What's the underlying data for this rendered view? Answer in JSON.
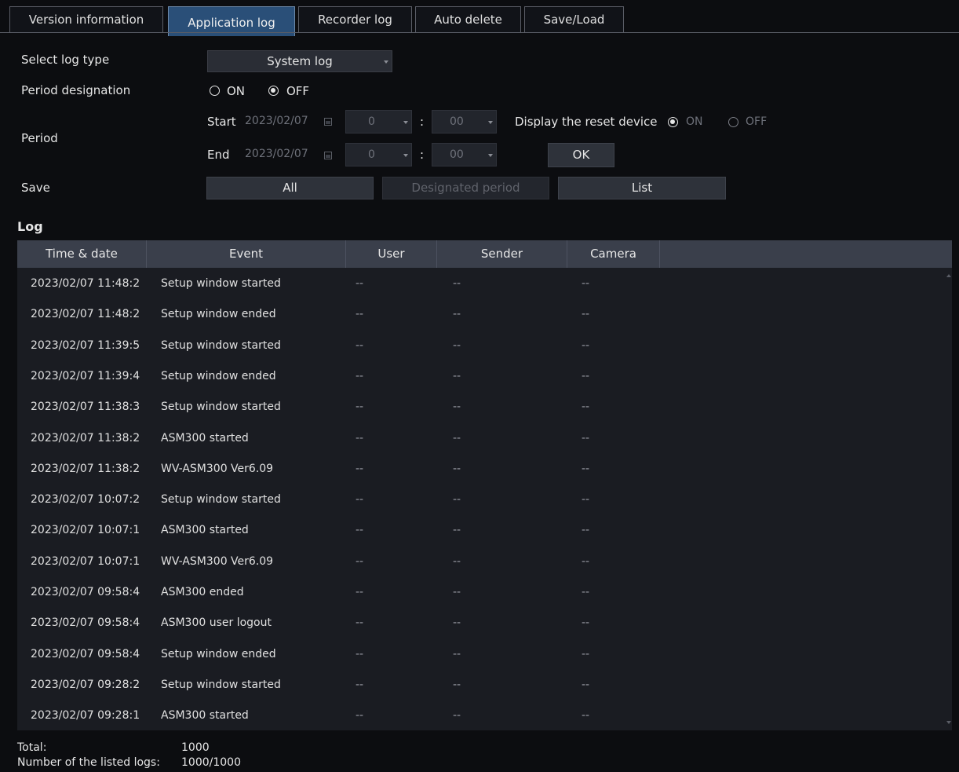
{
  "tabs": [
    {
      "label": "Version information",
      "active": false
    },
    {
      "label": "Application log",
      "active": true
    },
    {
      "label": "Recorder log",
      "active": false
    },
    {
      "label": "Auto delete",
      "active": false
    },
    {
      "label": "Save/Load",
      "active": false
    }
  ],
  "form": {
    "log_type_label": "Select log type",
    "log_type_value": "System log",
    "period_designation_label": "Period designation",
    "period_designation_on": "ON",
    "period_designation_off": "OFF",
    "period_designation_selected": "OFF",
    "period_label": "Period",
    "start_label": "Start",
    "start_date": "2023/02/07",
    "start_hour": "0",
    "start_minute": "00",
    "end_label": "End",
    "end_date": "2023/02/07",
    "end_hour": "0",
    "end_minute": "00",
    "time_separator": ":",
    "reset_device_label": "Display the reset device",
    "reset_device_on": "ON",
    "reset_device_off": "OFF",
    "reset_device_selected": "ON",
    "ok_label": "OK",
    "save_label": "Save",
    "save_all": "All",
    "save_designated": "Designated period",
    "save_list": "List"
  },
  "log": {
    "section_title": "Log",
    "columns": [
      "Time & date",
      "Event",
      "User",
      "Sender",
      "Camera"
    ],
    "rows": [
      {
        "time": "2023/02/07 11:48:2",
        "event": "Setup window started",
        "user": "--",
        "sender": "--",
        "camera": "--"
      },
      {
        "time": "2023/02/07 11:48:2",
        "event": "Setup window ended",
        "user": "--",
        "sender": "--",
        "camera": "--"
      },
      {
        "time": "2023/02/07 11:39:5",
        "event": "Setup window started",
        "user": "--",
        "sender": "--",
        "camera": "--"
      },
      {
        "time": "2023/02/07 11:39:4",
        "event": "Setup window ended",
        "user": "--",
        "sender": "--",
        "camera": "--"
      },
      {
        "time": "2023/02/07 11:38:3",
        "event": "Setup window started",
        "user": "--",
        "sender": "--",
        "camera": "--"
      },
      {
        "time": "2023/02/07 11:38:2",
        "event": "ASM300 started",
        "user": "--",
        "sender": "--",
        "camera": "--"
      },
      {
        "time": "2023/02/07 11:38:2",
        "event": "WV-ASM300 Ver6.09",
        "user": "--",
        "sender": "--",
        "camera": "--"
      },
      {
        "time": "2023/02/07 10:07:2",
        "event": "Setup window started",
        "user": "--",
        "sender": "--",
        "camera": "--"
      },
      {
        "time": "2023/02/07 10:07:1",
        "event": "ASM300 started",
        "user": "--",
        "sender": "--",
        "camera": "--"
      },
      {
        "time": "2023/02/07 10:07:1",
        "event": "WV-ASM300 Ver6.09",
        "user": "--",
        "sender": "--",
        "camera": "--"
      },
      {
        "time": "2023/02/07 09:58:4",
        "event": "ASM300 ended",
        "user": "--",
        "sender": "--",
        "camera": "--"
      },
      {
        "time": "2023/02/07 09:58:4",
        "event": "ASM300 user logout",
        "user": "--",
        "sender": "--",
        "camera": "--"
      },
      {
        "time": "2023/02/07 09:58:4",
        "event": "Setup window ended",
        "user": "--",
        "sender": "--",
        "camera": "--"
      },
      {
        "time": "2023/02/07 09:28:2",
        "event": "Setup window started",
        "user": "--",
        "sender": "--",
        "camera": "--"
      },
      {
        "time": "2023/02/07 09:28:1",
        "event": "ASM300 started",
        "user": "--",
        "sender": "--",
        "camera": "--"
      }
    ]
  },
  "footer": {
    "total_label": "Total:",
    "total_value": "1000",
    "listed_label": "Number of the listed logs:",
    "listed_value": "1000/1000"
  }
}
